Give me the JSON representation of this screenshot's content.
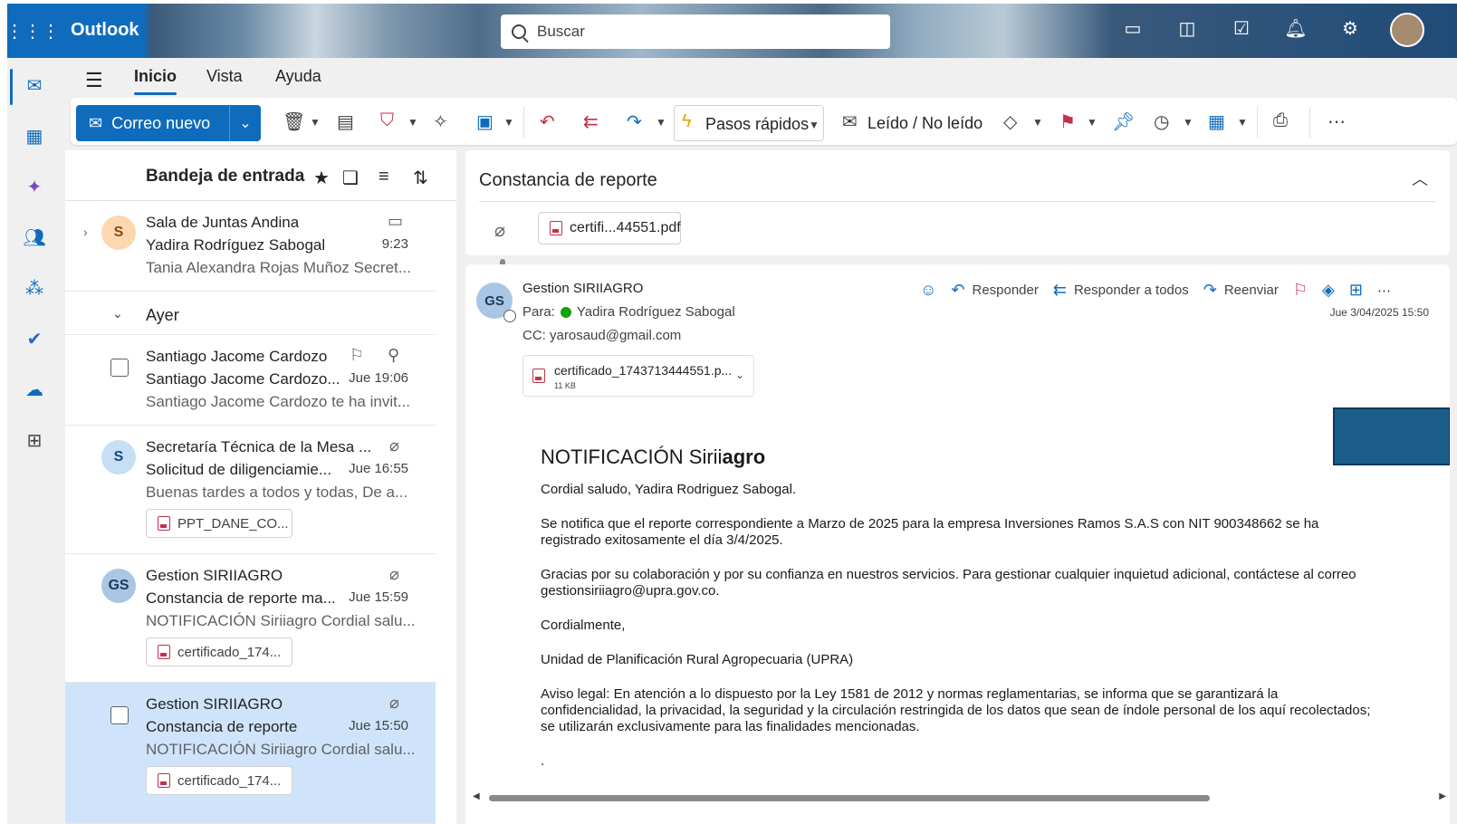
{
  "app": {
    "name": "Outlook",
    "search_placeholder": "Buscar"
  },
  "menu": {
    "tabs": [
      "Inicio",
      "Vista",
      "Ayuda"
    ],
    "active": "Inicio"
  },
  "ribbon": {
    "new_mail": "Correo nuevo",
    "quick_steps": "Pasos rápidos",
    "read_unread": "Leído / No leído"
  },
  "inbox": {
    "title": "Bandeja de entrada"
  },
  "messages": [
    {
      "l1": "Sala de Juntas Andina",
      "l2": "Yadira Rodríguez Sabogal",
      "l3": "Tania Alexandra Rojas Muñoz Secret...",
      "time": "9:23",
      "avatar": "S"
    },
    {
      "group": "Ayer"
    },
    {
      "l1": "Santiago Jacome Cardozo",
      "l2": "Santiago Jacome Cardozo...",
      "l3": "Santiago Jacome Cardozo te ha invit...",
      "time": "Jue 19:06"
    },
    {
      "l1": "Secretaría Técnica de la Mesa ...",
      "l2": "Solicitud de diligenciamie...",
      "l3": "Buenas tardes a todos y todas, De a...",
      "time": "Jue 16:55",
      "avatar": "S",
      "attachment": "PPT_DANE_CO..."
    },
    {
      "l1": "Gestion SIRIIAGRO",
      "l2": "Constancia de reporte ma...",
      "l3": "NOTIFICACIÓN Siriiagro Cordial salu...",
      "time": "Jue 15:59",
      "avatar": "GS",
      "attachment": "certificado_174..."
    },
    {
      "l1": "Gestion SIRIIAGRO",
      "l2": "Constancia de reporte",
      "l3": "NOTIFICACIÓN Siriiagro Cordial salu...",
      "time": "Jue 15:50",
      "attachment": "certificado_174..."
    }
  ],
  "reading": {
    "subject": "Constancia de reporte",
    "subject_attachment": "certifi...44551.pdf",
    "from": "Gestion SIRIIAGRO",
    "avatar": "GS",
    "to_label": "Para:",
    "to": "Yadira Rodríguez Sabogal",
    "cc_label": "CC:",
    "cc": "yarosaud@gmail.com",
    "reply": "Responder",
    "reply_all": "Responder a todos",
    "forward": "Reenviar",
    "date": "Jue 3/04/2025 15:50",
    "attachment_name": "certificado_1743713444551.p...",
    "attachment_size": "11 KB",
    "body": {
      "title_pre": "NOTIFICACIÓN Sirii",
      "title_bold": "agro",
      "greeting": "Cordial saludo, Yadira Rodriguez Sabogal.",
      "p1": "Se notifica que el reporte correspondiente a Marzo de 2025 para la empresa Inversiones Ramos S.A.S con NIT 900348662 se ha registrado exitosamente el día 3/4/2025.",
      "p2": "Gracias por su colaboración y por su confianza en nuestros servicios. Para gestionar cualquier inquietud adicional, contáctese al correo gestionsiriiagro@upra.gov.co.",
      "closing": "Cordialmente,",
      "org": "Unidad de Planificación Rural Agropecuaria (UPRA)",
      "legal": "Aviso legal: En atención a lo dispuesto por la Ley 1581 de 2012 y normas reglamentarias, se informa que se garantizará la confidencialidad, la privacidad, la seguridad y la circulación restringida de los datos que sean de índole personal de los aquí recolectados; se utilizarán exclusivamente para las finalidades mencionadas.",
      "trailing": "."
    }
  },
  "colors": {
    "accent": "#0f6cbd",
    "selected_row": "#cfe4fa"
  }
}
